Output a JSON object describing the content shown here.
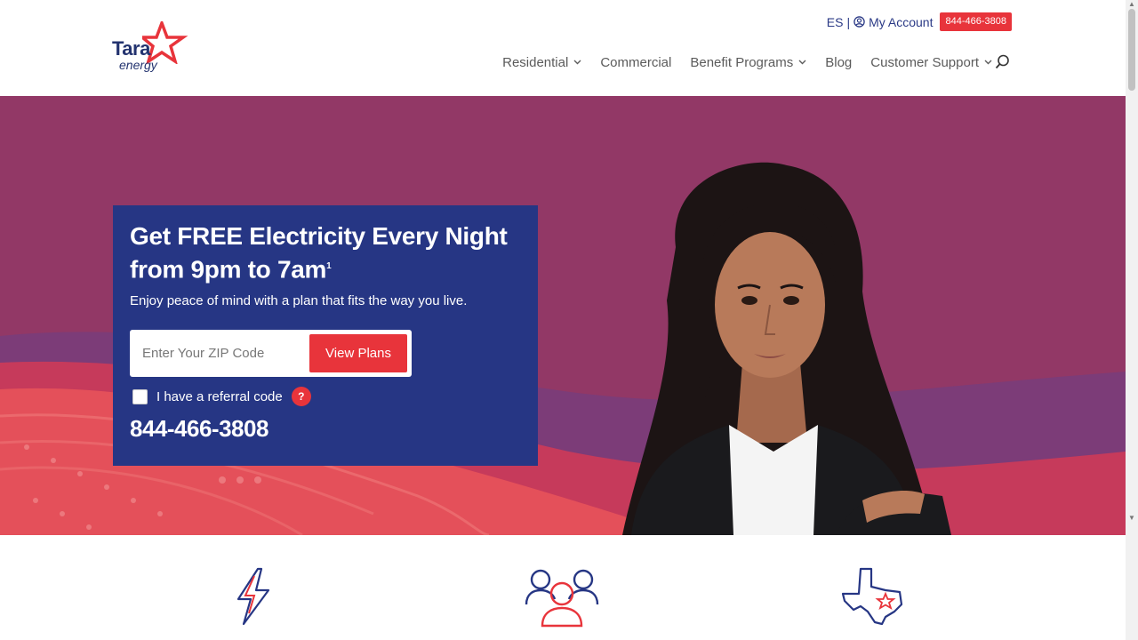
{
  "brand": {
    "name_main": "Tara",
    "name_sub": "energy",
    "primary": "#263684",
    "accent": "#e8343b",
    "hero_bg": "#923866"
  },
  "utility": {
    "lang": "ES",
    "separator": "|",
    "account": "My Account",
    "phone": "844-466-3808"
  },
  "nav": {
    "items": [
      {
        "label": "Residential",
        "has_dropdown": true
      },
      {
        "label": "Commercial",
        "has_dropdown": false
      },
      {
        "label": "Benefit Programs",
        "has_dropdown": true
      },
      {
        "label": "Blog",
        "has_dropdown": false
      },
      {
        "label": "Customer Support",
        "has_dropdown": true
      }
    ],
    "chevron": "⌄"
  },
  "hero": {
    "heading": "Get FREE Electricity Every Night from 9pm to 7am",
    "footnote": "1",
    "subheading": "Enjoy peace of mind with a plan that fits the way you live.",
    "zip_placeholder": "Enter Your ZIP Code",
    "button": "View Plans",
    "referral": "I have a referral code",
    "help": "?",
    "phone": "844-466-3808"
  },
  "features": [
    {
      "icon": "lightning-icon"
    },
    {
      "icon": "people-icon"
    },
    {
      "icon": "texas-star-icon"
    }
  ]
}
